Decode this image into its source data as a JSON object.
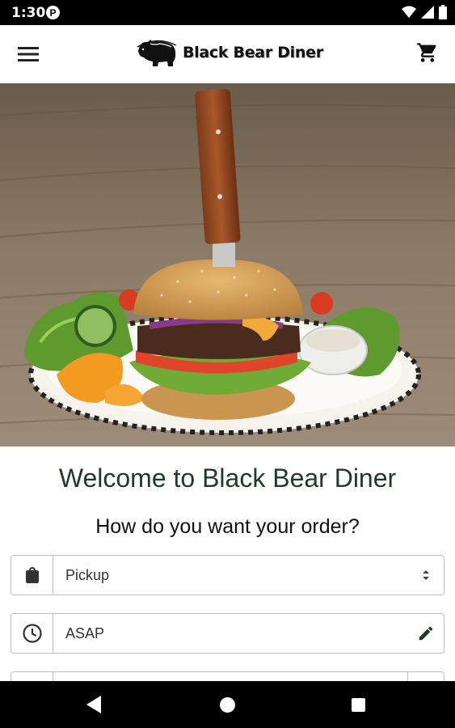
{
  "status_bar": {
    "time": "1:30",
    "notification_icon": "P"
  },
  "app_bar": {
    "logo_text": "Black Bear Diner",
    "menu_icon": "hamburger-menu-icon",
    "cart_icon": "cart-icon"
  },
  "main": {
    "welcome_title": "Welcome to Black Bear Diner",
    "order_question": "How do you want your order?",
    "order_type": {
      "value": "Pickup",
      "icon": "shopping-bag-icon"
    },
    "order_time": {
      "value": "ASAP",
      "icon": "clock-icon",
      "action_icon": "pencil-icon"
    }
  },
  "colors": {
    "title_green": "#1d3b26",
    "border": "#bdbdbd"
  }
}
